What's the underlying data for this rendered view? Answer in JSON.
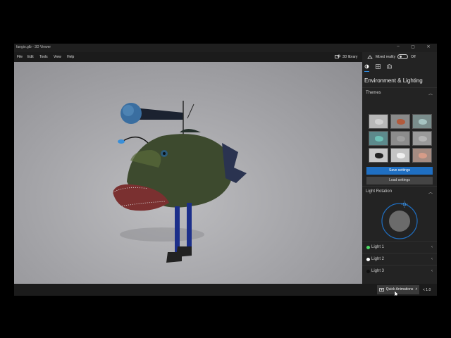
{
  "window": {
    "title": "fangio.glb - 3D Viewer",
    "controls": [
      "–",
      "▢",
      "✕"
    ]
  },
  "menu": {
    "items": [
      "File",
      "Edit",
      "Tools",
      "View",
      "Help"
    ],
    "library_label": "3D library"
  },
  "panel": {
    "mixed_reality_label": "Mixed reality",
    "toggle_state": "Off",
    "heading": "Environment & Lighting",
    "themes_label": "Themes",
    "themes": [
      {
        "bg": "#b8b8b8",
        "fish": "#d0d0d0"
      },
      {
        "bg": "#8a8a8a",
        "fish": "#b25a3c"
      },
      {
        "bg": "#7a8d8c",
        "fish": "#a6c4c2"
      },
      {
        "bg": "#5d8a8c",
        "fish": "#6ec1b7"
      },
      {
        "bg": "#8c8c8c",
        "fish": "#9f9f9f"
      },
      {
        "bg": "#9a9a9a",
        "fish": "#b5b5b5"
      },
      {
        "bg": "#c8c8c8",
        "fish": "#222222"
      },
      {
        "bg": "#c4c4c4",
        "fish": "#f0f0f0"
      },
      {
        "bg": "#a58c82",
        "fish": "#d69c88"
      }
    ],
    "save_settings_label": "Save settings",
    "load_settings_label": "Load settings",
    "light_rotation_label": "Light Rotation",
    "lights": [
      {
        "label": "Light 1",
        "color": "#4cd964"
      },
      {
        "label": "Light 2",
        "color": "#ffffff"
      },
      {
        "label": "Light 3",
        "color": "#111111"
      }
    ],
    "accent_color": "#1f6fc2"
  },
  "bottom": {
    "quick_animations_label": "Quick Animations",
    "speed_label": "< 1.0"
  }
}
